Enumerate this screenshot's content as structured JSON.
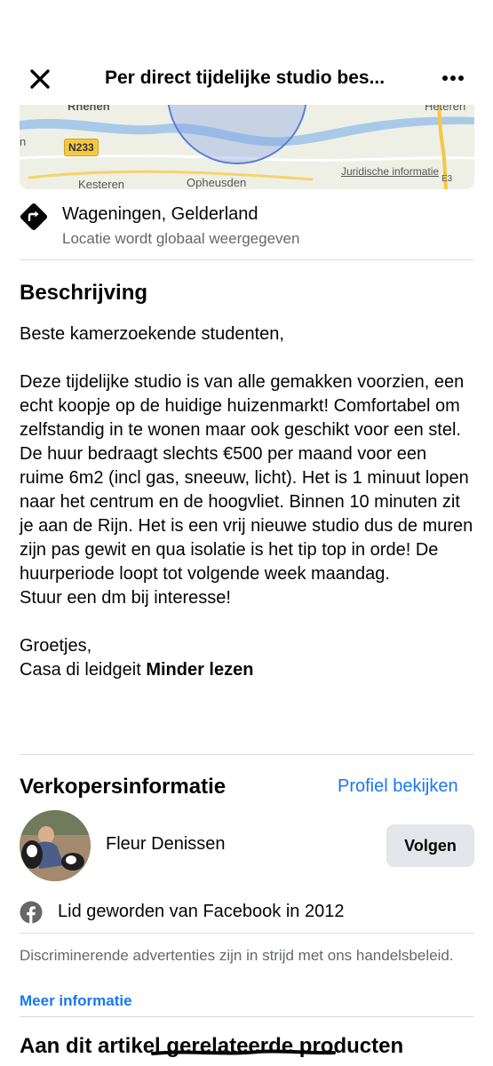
{
  "header": {
    "title": "Per direct tijdelijke studio bes...",
    "close_icon": "close-icon",
    "more_icon": "more-horizontal-icon"
  },
  "map": {
    "places": [
      "Rhenen",
      "Heteren",
      "Kesteren",
      "Opheusden"
    ],
    "road": "N233",
    "legal_link": "Juridische informatie",
    "edge_marks": [
      "n",
      "E3"
    ]
  },
  "location": {
    "icon": "directions-icon",
    "city": "Wageningen, Gelderland",
    "note": "Locatie wordt globaal weergegeven"
  },
  "description": {
    "heading": "Beschrijving",
    "body": "Beste kamerzoekende studenten,\n\nDeze tijdelijke studio is van alle gemakken voorzien, een echt koopje op de huidige huizenmarkt! Comfortabel om zelfstandig in te wonen maar ook geschikt voor een stel. De huur bedraagt slechts €500 per maand voor een ruime 6m2 (incl gas, sneeuw, licht). Het is 1 minuut lopen naar het centrum en de hoogvliet. Binnen 10 minuten zit je aan de Rijn. Het is een vrij nieuwe studio dus de muren zijn pas gewit en qua isolatie is het tip top in orde! De huurperiode loopt tot volgende week maandag.\nStuur een dm bij interesse!\n\nGroetjes,\nCasa di leidgeit ",
    "less_link": "Minder lezen"
  },
  "seller": {
    "heading": "Verkopersinformatie",
    "profile_link": "Profiel bekijken",
    "name": "Fleur Denissen",
    "follow_label": "Volgen",
    "member_since": "Lid geworden van Facebook in 2012"
  },
  "policy": {
    "text": "Discriminerende advertenties zijn in strijd met ons handelsbeleid.",
    "more_info": "Meer informatie"
  },
  "related": {
    "heading": "Aan dit artikel gerelateerde producten"
  },
  "colors": {
    "link_blue": "#1877f2",
    "secondary_text": "#65676b",
    "button_grey": "#e4e6eb",
    "divider": "#dadde1"
  }
}
